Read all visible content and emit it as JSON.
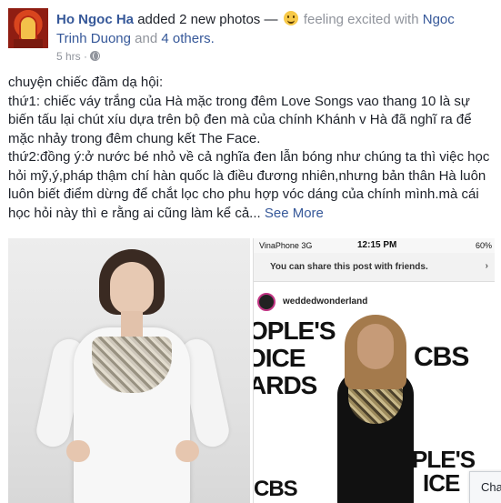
{
  "post": {
    "author": "Ho Ngoc Ha",
    "action": "added 2 new photos —",
    "feeling_prefix": "feeling excited with",
    "tagged_name": "Ngoc Trinh Duong",
    "and_text": "and",
    "others_text": "4 others.",
    "timestamp": "5 hrs ·",
    "privacy_icon": "globe-icon",
    "emoji_icon": "smiley-emoji-icon",
    "body_lines": [
      "chuyện chiếc đầm dạ hội:",
      "thứ1: chiếc váy trắng của Hà mặc trong đêm Love Songs vao thang 10 là sự biến tấu lại chút xíu dựa trên bộ đen mà của chính Khánh v Hà đã nghĩ ra để mặc nhảy trong đêm chung kết The Face.",
      "thứ2:đồng ý:ở nước bé nhỏ về cả nghĩa đen lẫn bóng như chúng ta thì việc học hỏi mỹ,ý,pháp thậm chí hàn quốc là điều đương nhiên,nhưng bản thân Hà luôn luôn biết điểm dừng để chắt lọc cho phu hợp vóc dáng của chính mình.mà cái học hỏi này thì e rằng ai cũng làm kể cả..."
    ],
    "see_more": "See More"
  },
  "phone_screenshot": {
    "carrier": "VinaPhone 3G",
    "time": "12:15 PM",
    "battery": "60%",
    "share_note": "You can share this post with friends.",
    "account": "weddedwonderland",
    "backdrop_lines": [
      "OPLE'S",
      "OICE",
      "ARDS",
      "CBS",
      "PLE'S",
      "ICE",
      "CBS"
    ]
  },
  "chat": {
    "label": "Cha"
  },
  "colors": {
    "link": "#365899",
    "text": "#1d2129",
    "muted": "#90949c"
  }
}
